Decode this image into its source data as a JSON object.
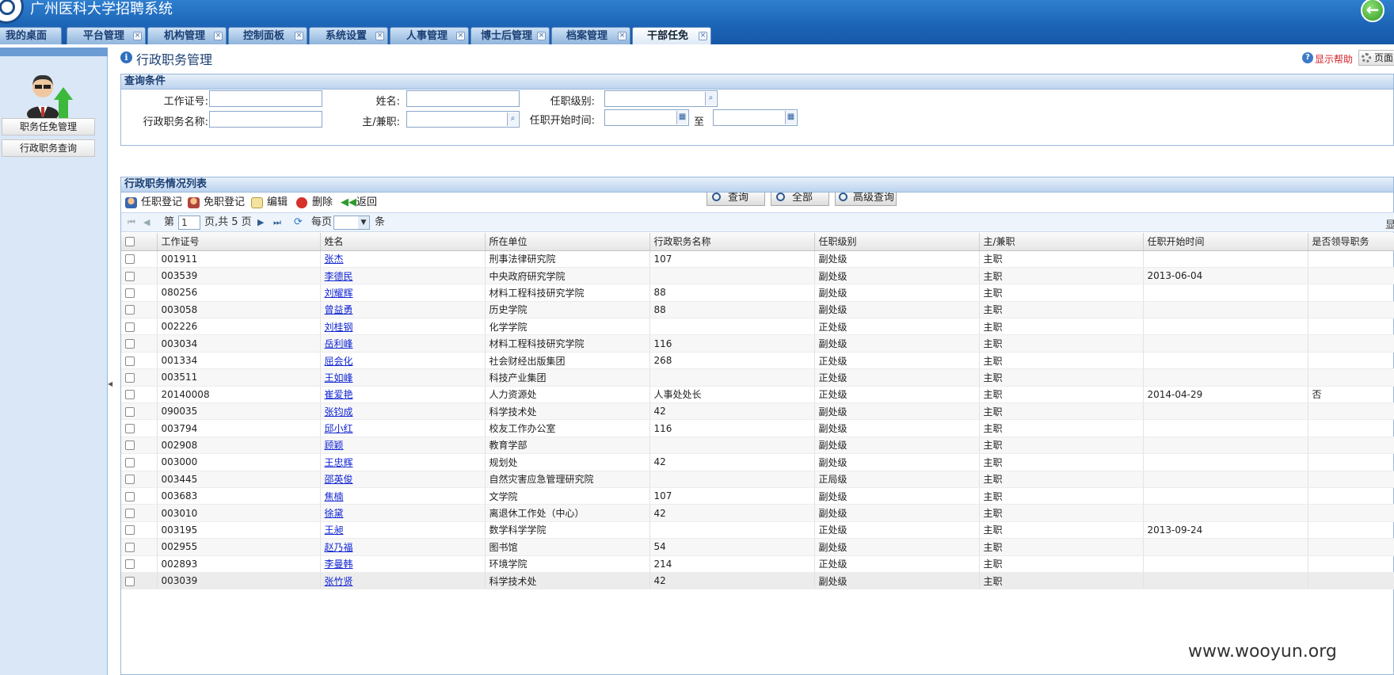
{
  "app": {
    "title": "广州医科大学招聘系统"
  },
  "tabs": [
    {
      "label": "我的桌面"
    },
    {
      "label": "平台管理"
    },
    {
      "label": "机构管理"
    },
    {
      "label": "控制面板"
    },
    {
      "label": "系统设置"
    },
    {
      "label": "人事管理"
    },
    {
      "label": "博士后管理"
    },
    {
      "label": "档案管理"
    },
    {
      "label": "干部任免"
    }
  ],
  "sidebar": {
    "items": [
      {
        "label": "职务任免管理"
      },
      {
        "label": "行政职务查询"
      }
    ]
  },
  "page": {
    "title": "行政职务管理",
    "help": "显示帮助",
    "page_btn": "页面"
  },
  "query": {
    "title": "查询条件",
    "work_id_label": "工作证号:",
    "name_label": "姓名:",
    "rank_label": "任职级别:",
    "post_name_label": "行政职务名称:",
    "main_part_label": "主/兼职:",
    "start_time_label": "任职开始时间:",
    "to_label": "至",
    "search_btn": "查询",
    "all_btn": "全部",
    "advanced_btn": "高级查询"
  },
  "list": {
    "title": "行政职务情况列表",
    "toolbar": {
      "appoint": "任职登记",
      "dismiss": "免职登记",
      "edit": "编辑",
      "delete": "删除",
      "back": "返回"
    },
    "pager": {
      "page_prefix": "第",
      "page": "1",
      "page_suffix": "页,共 5 页",
      "per_page_label": "每页",
      "per_page_unit": "条",
      "show": "显"
    },
    "columns": [
      "工作证号",
      "姓名",
      "所在单位",
      "行政职务名称",
      "任职级别",
      "主/兼职",
      "任职开始时间",
      "是否领导职务"
    ],
    "rows": [
      [
        "001911",
        "张杰",
        "刑事法律研究院",
        "107",
        "副处级",
        "主职",
        "",
        ""
      ],
      [
        "003539",
        "李德民",
        "中央政府研究学院",
        "",
        "副处级",
        "主职",
        "2013-06-04",
        ""
      ],
      [
        "080256",
        "刘耀辉",
        "材料工程科技研究学院",
        "88",
        "副处级",
        "主职",
        "",
        ""
      ],
      [
        "003058",
        "曾益勇",
        "历史学院",
        "88",
        "副处级",
        "主职",
        "",
        ""
      ],
      [
        "002226",
        "刘桂钢",
        "化学学院",
        "",
        "正处级",
        "主职",
        "",
        ""
      ],
      [
        "003034",
        "岳利峰",
        "材料工程科技研究学院",
        "116",
        "副处级",
        "主职",
        "",
        ""
      ],
      [
        "001334",
        "屈会化",
        "社会财经出版集团",
        "268",
        "正处级",
        "主职",
        "",
        ""
      ],
      [
        "003511",
        "王如峰",
        "科技产业集团",
        "",
        "正处级",
        "主职",
        "",
        ""
      ],
      [
        "20140008",
        "崔爱艳",
        "人力资源处",
        "人事处处长",
        "正处级",
        "主职",
        "2014-04-29",
        "否"
      ],
      [
        "090035",
        "张钧成",
        "科学技术处",
        "42",
        "副处级",
        "主职",
        "",
        ""
      ],
      [
        "003794",
        "邱小红",
        "校友工作办公室",
        "116",
        "副处级",
        "主职",
        "",
        ""
      ],
      [
        "002908",
        "顾颖",
        "教育学部",
        "",
        "副处级",
        "主职",
        "",
        ""
      ],
      [
        "003000",
        "王忠辉",
        "规划处",
        "42",
        "副处级",
        "主职",
        "",
        ""
      ],
      [
        "003445",
        "邵英俊",
        "自然灾害应急管理研究院",
        "",
        "正局级",
        "主职",
        "",
        ""
      ],
      [
        "003683",
        "焦楠",
        "文学院",
        "107",
        "副处级",
        "主职",
        "",
        ""
      ],
      [
        "003010",
        "徐黛",
        "离退休工作处（中心）",
        "42",
        "副处级",
        "主职",
        "",
        ""
      ],
      [
        "003195",
        "王昶",
        "数学科学学院",
        "",
        "正处级",
        "主职",
        "2013-09-24",
        ""
      ],
      [
        "002955",
        "赵乃福",
        "图书馆",
        "54",
        "副处级",
        "主职",
        "",
        ""
      ],
      [
        "002893",
        "李曼韩",
        "环境学院",
        "214",
        "正处级",
        "主职",
        "",
        ""
      ],
      [
        "003039",
        "张竹贤",
        "科学技术处",
        "42",
        "副处级",
        "主职",
        "",
        ""
      ]
    ]
  },
  "watermark": "www.wooyun.org",
  "colors": {
    "header": "#1b63b5",
    "link": "#1226d3",
    "help": "#d2232a"
  }
}
